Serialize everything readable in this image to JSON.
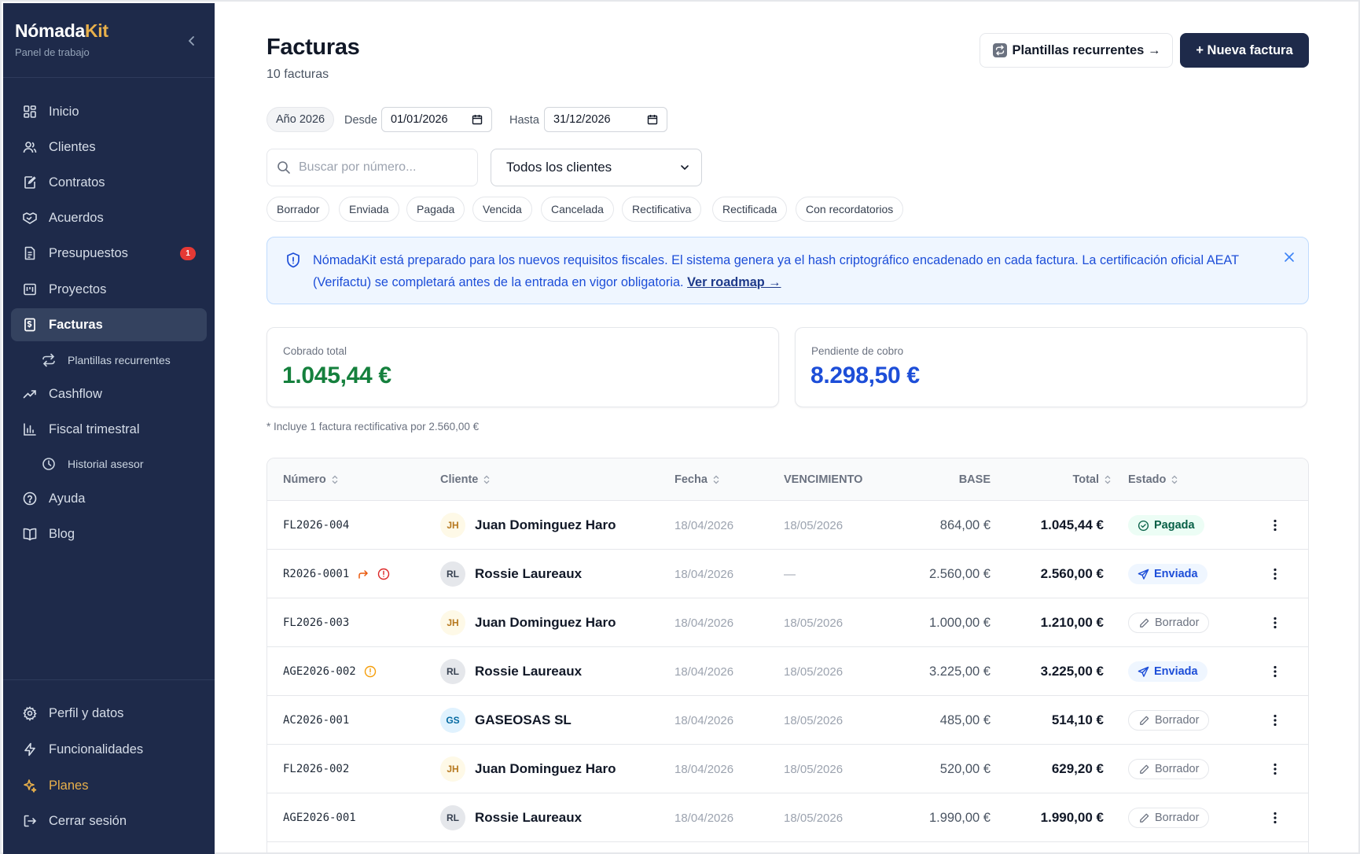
{
  "brand": {
    "name": "Nómada",
    "accent": "Kit",
    "subtitle": "Panel de trabajo"
  },
  "nav": {
    "items": [
      {
        "label": "Inicio",
        "icon": "dashboard-icon"
      },
      {
        "label": "Clientes",
        "icon": "users-icon"
      },
      {
        "label": "Contratos",
        "icon": "contract-icon"
      },
      {
        "label": "Acuerdos",
        "icon": "handshake-icon"
      },
      {
        "label": "Presupuestos",
        "icon": "document-icon",
        "badge": "1"
      },
      {
        "label": "Proyectos",
        "icon": "kanban-icon"
      },
      {
        "label": "Facturas",
        "icon": "invoice-icon",
        "active": true
      },
      {
        "label": "Plantillas recurrentes",
        "icon": "repeat-icon",
        "sub": true
      },
      {
        "label": "Cashflow",
        "icon": "trend-icon"
      },
      {
        "label": "Fiscal trimestral",
        "icon": "bar-chart-icon"
      },
      {
        "label": "Historial asesor",
        "icon": "clock-icon",
        "sub": true
      },
      {
        "label": "Ayuda",
        "icon": "help-icon"
      },
      {
        "label": "Blog",
        "icon": "book-icon"
      }
    ],
    "bottom": [
      {
        "label": "Perfil y datos",
        "icon": "gear-icon"
      },
      {
        "label": "Funcionalidades",
        "icon": "bolt-icon"
      },
      {
        "label": "Planes",
        "icon": "sparkle-icon"
      },
      {
        "label": "Cerrar sesión",
        "icon": "logout-icon"
      }
    ]
  },
  "header": {
    "title": "Facturas",
    "count": "10 facturas",
    "templates_button": "Plantillas recurrentes →",
    "new_button": "+ Nueva factura"
  },
  "filters": {
    "year": "Año 2026",
    "from_label": "Desde",
    "from_value": "01/01/2026",
    "to_label": "Hasta",
    "to_value": "31/12/2026",
    "search_placeholder": "Buscar por número...",
    "client_select": "Todos los clientes",
    "chips": [
      "Borrador",
      "Enviada",
      "Pagada",
      "Vencida",
      "Cancelada",
      "Rectificativa",
      "Rectificada",
      "Con recordatorios"
    ]
  },
  "banner": {
    "text": "NómadaKit está preparado para los nuevos requisitos fiscales. El sistema genera ya el hash criptográfico encadenado en cada factura. La certificación oficial AEAT (Verifactu) se completará antes de la entrada en vigor obligatoria.",
    "link": "Ver roadmap →"
  },
  "summary": {
    "collected_label": "Cobrado total",
    "collected_value": "1.045,44 €",
    "pending_label": "Pendiente de cobro",
    "pending_value": "8.298,50 €",
    "note": "* Incluye 1 factura rectificativa por 2.560,00 €"
  },
  "colors": {
    "sidebar": "#1e2a4a",
    "accent": "#e8b04b",
    "collected": "#15803d",
    "pending": "#1d4ed8"
  },
  "table": {
    "headers": {
      "number": "Número",
      "client": "Cliente",
      "date": "Fecha",
      "due": "VENCIMIENTO",
      "base": "BASE",
      "total": "Total",
      "status": "Estado"
    },
    "rows": [
      {
        "number": "FL2026-004",
        "initials": "JH",
        "client": "Juan Dominguez Haro",
        "date": "18/04/2026",
        "due": "18/05/2026",
        "base": "864,00 €",
        "total": "1.045,44 €",
        "status": "Pagada",
        "kind": "pagada"
      },
      {
        "number": "R2026-0001",
        "initials": "RL",
        "client": "Rossie Laureaux",
        "date": "18/04/2026",
        "due": "—",
        "base": "2.560,00 €",
        "total": "2.560,00 €",
        "status": "Enviada",
        "kind": "enviada",
        "flags": [
          "redirect-icon",
          "alert-icon-red"
        ]
      },
      {
        "number": "FL2026-003",
        "initials": "JH",
        "client": "Juan Dominguez Haro",
        "date": "18/04/2026",
        "due": "18/05/2026",
        "base": "1.000,00 €",
        "total": "1.210,00 €",
        "status": "Borrador",
        "kind": "borrador"
      },
      {
        "number": "AGE2026-002",
        "initials": "RL",
        "client": "Rossie Laureaux",
        "date": "18/04/2026",
        "due": "18/05/2026",
        "base": "3.225,00 €",
        "total": "3.225,00 €",
        "status": "Enviada",
        "kind": "enviada",
        "flags": [
          "alert-icon-orange"
        ]
      },
      {
        "number": "AC2026-001",
        "initials": "GS",
        "client": "GASEOSAS SL",
        "date": "18/04/2026",
        "due": "18/05/2026",
        "base": "485,00 €",
        "total": "514,10 €",
        "status": "Borrador",
        "kind": "borrador"
      },
      {
        "number": "FL2026-002",
        "initials": "JH",
        "client": "Juan Dominguez Haro",
        "date": "18/04/2026",
        "due": "18/05/2026",
        "base": "520,00 €",
        "total": "629,20 €",
        "status": "Borrador",
        "kind": "borrador"
      },
      {
        "number": "AGE2026-001",
        "initials": "RL",
        "client": "Rossie Laureaux",
        "date": "18/04/2026",
        "due": "18/05/2026",
        "base": "1.990,00 €",
        "total": "1.990,00 €",
        "status": "Borrador",
        "kind": "borrador"
      }
    ]
  }
}
